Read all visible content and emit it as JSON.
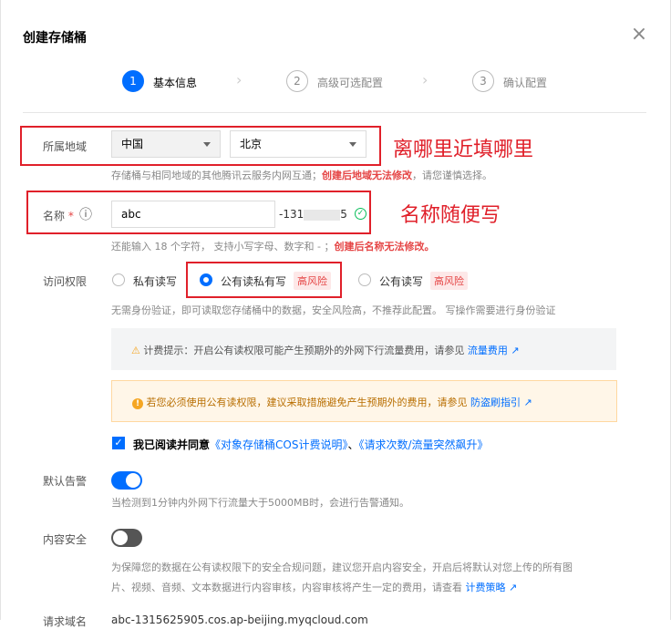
{
  "dialog": {
    "title": "创建存储桶",
    "close_label": "×"
  },
  "steps": [
    {
      "num": "1",
      "label": "基本信息"
    },
    {
      "num": "2",
      "label": "高级可选配置"
    },
    {
      "num": "3",
      "label": "确认配置"
    }
  ],
  "region": {
    "label": "所属地域",
    "area_value": "中国",
    "city_value": "北京",
    "hint_prefix": "存储桶与相同地域的其他腾讯云服务内网互通；",
    "hint_warning": "创建后地域无法修改",
    "hint_suffix": "，请您谨慎选择。",
    "annotation": "离哪里近填哪里"
  },
  "name": {
    "label": "名称",
    "required_mark": "*",
    "info_icon": "ⓘ",
    "value": "abc",
    "suffix": "-131",
    "suffix_tail": "5",
    "hint_prefix": "还能输入 18 个字符， 支持小写字母、数字和 - ；",
    "hint_warning": "创建后名称无法修改。",
    "annotation": "名称随便写"
  },
  "access": {
    "label": "访问权限",
    "options": [
      {
        "label": "私有读写",
        "risk": ""
      },
      {
        "label": "公有读私有写",
        "risk": "高风险"
      },
      {
        "label": "公有读写",
        "risk": "高风险"
      }
    ],
    "hint": "无需身份验证，即可读取您存储桶中的数据，安全风险高，不推荐此配置。 写操作需要进行身份验证",
    "notice_billing": {
      "icon": "⚠",
      "text": "计费提示：开启公有读权限可能产生预期外的外网下行流量费用，请参见",
      "link": "流量费用"
    },
    "notice_warn": {
      "icon": "!",
      "text": "若您必须使用公有读权限，建议采取措施避免产生预期外的费用，请参见",
      "link": "防盗刷指引"
    },
    "agree_check": "✓",
    "agree_text": "我已阅读并同意",
    "agree_link1": "《对象存储桶COS计费说明》",
    "agree_sep": "、",
    "agree_link2": "《请求次数/流量突然飙升》"
  },
  "alert": {
    "label": "默认告警",
    "hint": "当检测到1分钟内外网下行流量大于5000MB时，会进行告警通知。"
  },
  "content_security": {
    "label": "内容安全",
    "hint_line1": "为保障您的数据在公有读权限下的安全合规问题，建议您开启内容安全，开启后将默认对您上传的所有图",
    "hint_line2": "片、视频、音频、文本数据进行内容审核，内容审核将产生一定的费用，请查看",
    "hint_link": "计费策略"
  },
  "request_domain": {
    "label": "请求域名",
    "value": "abc-1315625905.cos.ap-beijing.myqcloud.com"
  },
  "colors": {
    "accent": "#006eff",
    "danger": "#e54545",
    "annotation": "#e0202a"
  }
}
